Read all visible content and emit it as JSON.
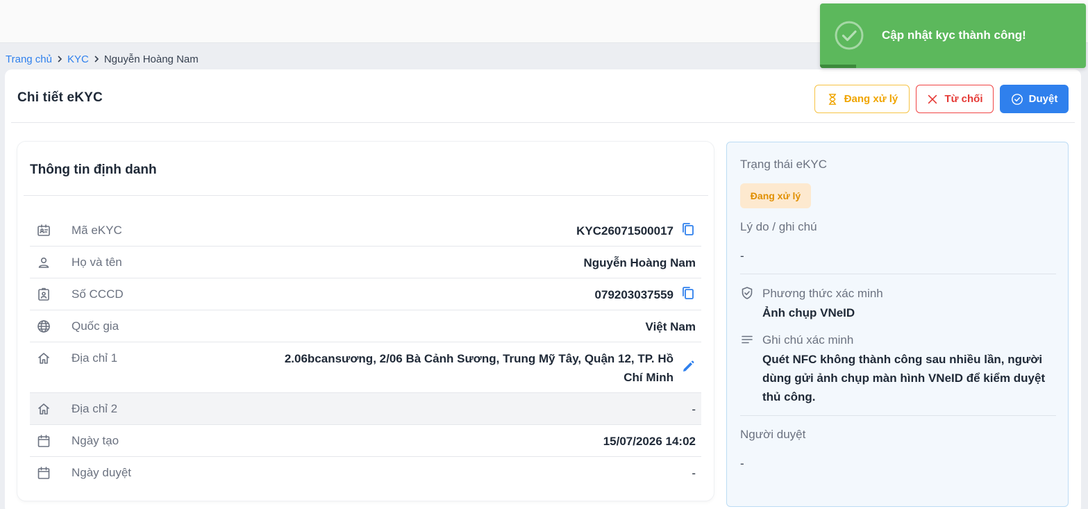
{
  "breadcrumb": {
    "items": [
      "Trang chủ",
      "KYC"
    ],
    "current": "Nguyễn Hoàng Nam"
  },
  "header": {
    "title": "Chi tiết eKYC",
    "actions": {
      "pending_label": "Đang xử lý",
      "reject_label": "Từ chối",
      "approve_label": "Duyệt"
    }
  },
  "info": {
    "title": "Thông tin định danh",
    "rows": [
      {
        "icon": "id-card-icon",
        "label": "Mã eKYC",
        "value": "KYC26071500017",
        "action": "copy-icon"
      },
      {
        "icon": "person-icon",
        "label": "Họ và tên",
        "value": "Nguyễn Hoàng Nam"
      },
      {
        "icon": "badge-icon",
        "label": "Số CCCD",
        "value": "079203037559",
        "action": "copy-icon"
      },
      {
        "icon": "globe-icon",
        "label": "Quốc gia",
        "value": "Việt Nam"
      },
      {
        "icon": "home-icon",
        "label": "Địa chỉ 1",
        "value": "2.06bcansương, 2/06 Bà Cảnh Sương, Trung Mỹ Tây, Quận 12, TP. Hồ Chí Minh",
        "action": "edit-icon"
      },
      {
        "icon": "home-icon",
        "label": "Địa chỉ 2",
        "value": "-"
      },
      {
        "icon": "calendar-icon",
        "label": "Ngày tạo",
        "value": "15/07/2026 14:02"
      },
      {
        "icon": "calendar-icon",
        "label": "Ngày duyệt",
        "value": "-"
      }
    ]
  },
  "status": {
    "status_label": "Trạng thái eKYC",
    "status_badge": "Đang xử lý",
    "reason_label": "Lý do / ghi chú",
    "reason_value": "-",
    "method_label": "Phương thức xác minh",
    "method_value": "Ảnh chụp VNeID",
    "note_label": "Ghi chú xác minh",
    "note_value": "Quét NFC không thành công sau nhiều lần, người dùng gửi ảnh chụp màn hình VNeID để kiểm duyệt thủ công.",
    "reviewer_label": "Người duyệt",
    "reviewer_value": "-"
  },
  "toast": {
    "message": "Cập nhật kyc thành công!"
  },
  "colors": {
    "primary": "#2f80ed",
    "warning": "#f0a500",
    "danger": "#e53935",
    "success": "#5cb85c"
  }
}
